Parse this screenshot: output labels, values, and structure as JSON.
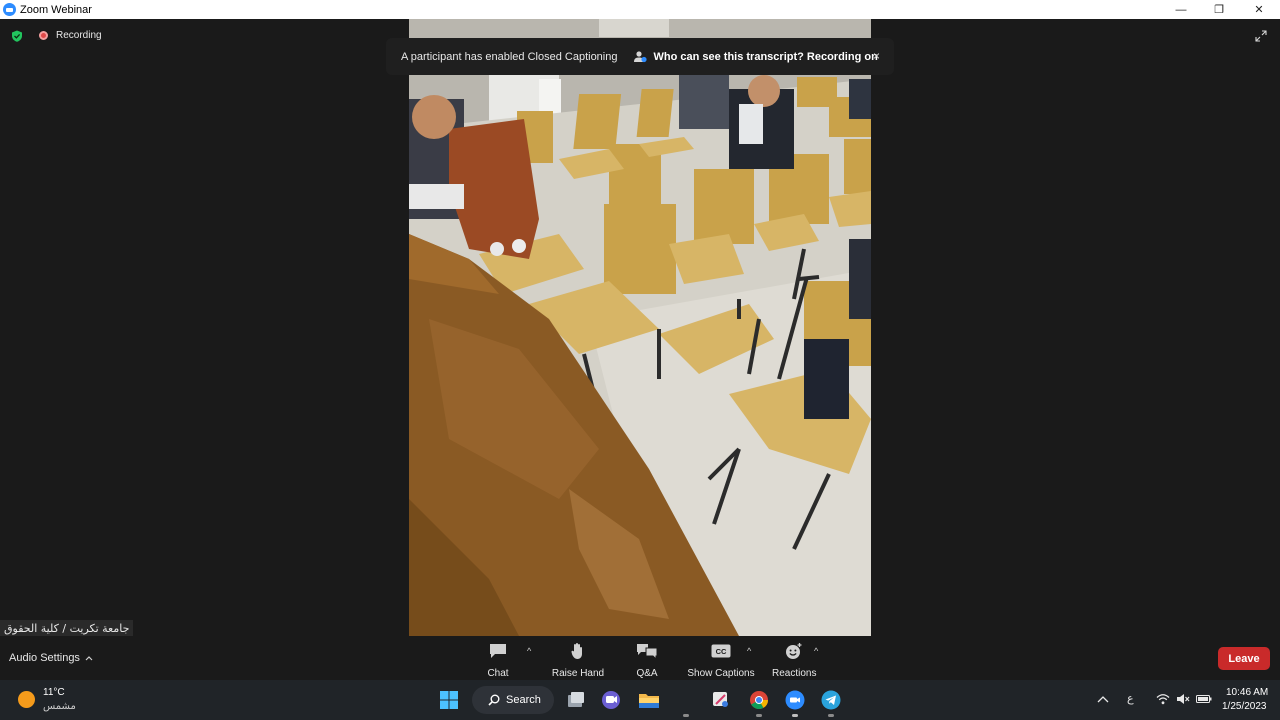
{
  "window": {
    "title": "Zoom Webinar",
    "minimize": "—",
    "restore": "❐",
    "close": "✕"
  },
  "status": {
    "recording_label": "Recording"
  },
  "banner": {
    "message": "A participant has enabled Closed Captioning",
    "link": "Who can see this transcript? Recording on",
    "close": "×"
  },
  "participant": {
    "name": "جامعة تكريت / كلية الحقوق"
  },
  "toolbar": {
    "audio_settings": "Audio Settings",
    "chat": "Chat",
    "raise_hand": "Raise Hand",
    "qa": "Q&A",
    "show_captions": "Show Captions",
    "reactions": "Reactions",
    "leave": "Leave",
    "caret": "^"
  },
  "taskbar": {
    "weather_temp": "11°C",
    "weather_condition": "مشمس",
    "search_label": "Search",
    "language": "ع",
    "time": "10:46 AM",
    "date": "1/25/2023"
  },
  "colors": {
    "leave": "#c92a2a",
    "recording": "#e04a4a",
    "shield": "#22c55e",
    "zoom_blue": "#2d8cff"
  }
}
